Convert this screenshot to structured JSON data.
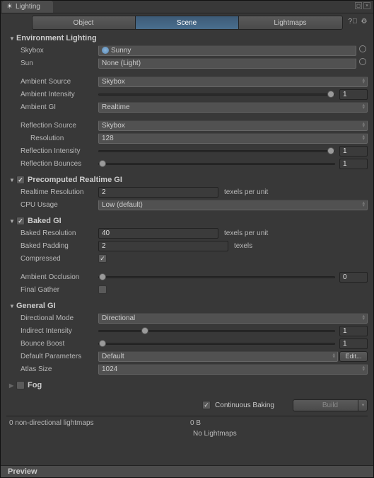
{
  "window": {
    "title": "Lighting"
  },
  "tabs": {
    "object": "Object",
    "scene": "Scene",
    "lightmaps": "Lightmaps"
  },
  "env": {
    "header": "Environment Lighting",
    "skybox_lbl": "Skybox",
    "skybox_val": "Sunny",
    "sun_lbl": "Sun",
    "sun_val": "None (Light)",
    "amb_src_lbl": "Ambient Source",
    "amb_src_val": "Skybox",
    "amb_int_lbl": "Ambient Intensity",
    "amb_int_val": "1",
    "amb_gi_lbl": "Ambient GI",
    "amb_gi_val": "Realtime",
    "ref_src_lbl": "Reflection Source",
    "ref_src_val": "Skybox",
    "res_lbl": "Resolution",
    "res_val": "128",
    "ref_int_lbl": "Reflection Intensity",
    "ref_int_val": "1",
    "ref_b_lbl": "Reflection Bounces",
    "ref_b_val": "1"
  },
  "rtgi": {
    "header": "Precomputed Realtime GI",
    "res_lbl": "Realtime Resolution",
    "res_val": "2",
    "res_unit": "texels per unit",
    "cpu_lbl": "CPU Usage",
    "cpu_val": "Low (default)"
  },
  "baked": {
    "header": "Baked GI",
    "res_lbl": "Baked Resolution",
    "res_val": "40",
    "res_unit": "texels per unit",
    "pad_lbl": "Baked Padding",
    "pad_val": "2",
    "pad_unit": "texels",
    "comp_lbl": "Compressed",
    "ao_lbl": "Ambient Occlusion",
    "ao_val": "0",
    "fg_lbl": "Final Gather"
  },
  "gen": {
    "header": "General GI",
    "dm_lbl": "Directional Mode",
    "dm_val": "Directional",
    "ii_lbl": "Indirect Intensity",
    "ii_val": "1",
    "bb_lbl": "Bounce Boost",
    "bb_val": "1",
    "dp_lbl": "Default Parameters",
    "dp_val": "Default",
    "dp_edit": "Edit...",
    "as_lbl": "Atlas Size",
    "as_val": "1024"
  },
  "fog": {
    "header": "Fog"
  },
  "bake": {
    "cb": "Continuous Baking",
    "build": "Build"
  },
  "status": {
    "lm": "0 non-directional lightmaps",
    "size": "0 B",
    "none": "No Lightmaps"
  },
  "preview": "Preview"
}
